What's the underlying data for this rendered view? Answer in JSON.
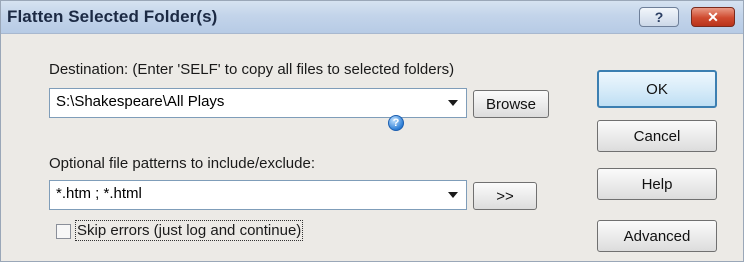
{
  "window": {
    "title": "Flatten Selected Folder(s)",
    "help_glyph": "?",
    "close_glyph": "✕"
  },
  "destination": {
    "label": "Destination: (Enter 'SELF' to copy all files to selected folders)",
    "value": "S:\\Shakespeare\\All Plays",
    "browse_label": "Browse"
  },
  "patterns": {
    "label": "Optional file patterns to include/exclude:",
    "info_glyph": "?",
    "value": "*.htm ; *.html",
    "more_label": ">>"
  },
  "skip_errors": {
    "label": "Skip errors (just log and continue)",
    "checked": false
  },
  "buttons": {
    "ok": "OK",
    "cancel": "Cancel",
    "help": "Help",
    "advanced": "Advanced"
  },
  "colors": {
    "titlebar": "#c3d4ea",
    "close_button": "#cf4a2f",
    "default_button_border": "#3c7fb1",
    "dialog_background": "#eceae6"
  }
}
